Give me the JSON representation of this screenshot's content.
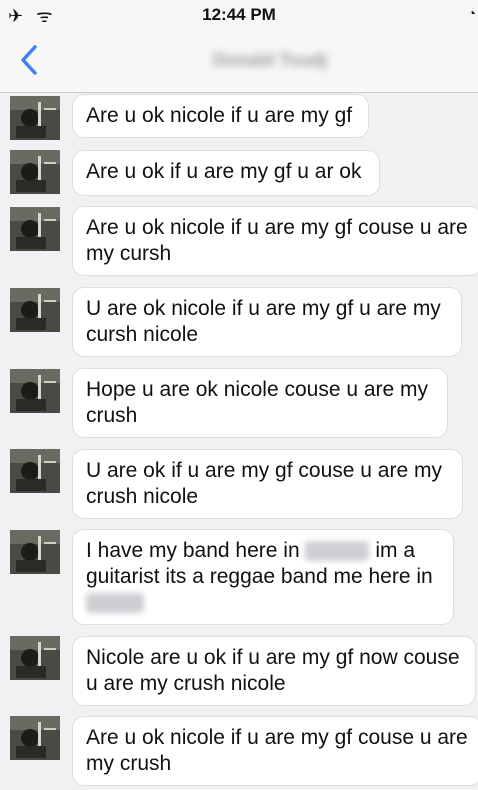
{
  "status_bar": {
    "left_icons": "✈ ᯤ",
    "time": "12:44 PM",
    "right_icon": "◔"
  },
  "nav": {
    "title": "Donald Toudj"
  },
  "messages": [
    {
      "text": "Are u ok nicole if u are my gf"
    },
    {
      "text": "Are u ok if u are my gf u ar ok"
    },
    {
      "text": "Are u ok nicole if u are my gf couse u are my cursh"
    },
    {
      "text": "U are ok nicole if u are my gf u are my cursh nicole"
    },
    {
      "text": "Hope u are ok nicole couse u are my crush"
    },
    {
      "text": "U are ok if u are my gf couse u are my crush nicole"
    },
    {
      "part1": "I have my band here in",
      "redacted1": "xxxxx",
      "part2": "im a guitarist its a reggae band me here in",
      "redacted2": "xxxxx"
    },
    {
      "text": "Nicole are u ok if u are my gf now couse u are my crush nicole"
    },
    {
      "text": "Are u ok nicole if u are my gf couse u are my crush"
    }
  ],
  "colors": {
    "accent": "#3b82f6",
    "bubble": "#ffffff",
    "background": "#f1f1f3"
  }
}
